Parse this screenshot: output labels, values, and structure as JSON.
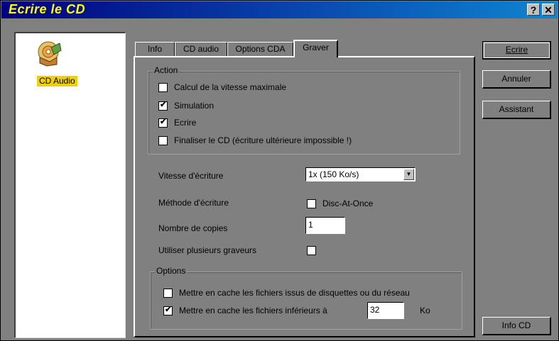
{
  "window": {
    "title": "Ecrire le CD",
    "help_button": "?",
    "close_button": "✕"
  },
  "left_pane": {
    "item_label": "CD Audio",
    "item_icon": "cd-audio-icon"
  },
  "tabs": [
    {
      "label": "Info"
    },
    {
      "label": "CD audio"
    },
    {
      "label": "Options CDA"
    },
    {
      "label": "Graver",
      "active": true
    }
  ],
  "action_group": {
    "title": "Action",
    "items": [
      {
        "label": "Calcul de la vitesse maximale",
        "checked": false
      },
      {
        "label": "Simulation",
        "checked": true
      },
      {
        "label": "Ecrire",
        "checked": true
      },
      {
        "label": "Finaliser le CD (écriture ultérieure impossible !)",
        "checked": false
      }
    ]
  },
  "settings": {
    "speed_label": "Vitesse d'écriture",
    "speed_value": "1x (150 Ko/s)",
    "method_label": "Méthode d'écriture",
    "method_option": "Disc-At-Once",
    "copies_label": "Nombre de copies",
    "copies_value": "1",
    "multi_label": "Utiliser plusieurs graveurs"
  },
  "options_group": {
    "title": "Options",
    "cache_network_label": "Mettre en cache les fichiers issus de disquettes ou du réseau",
    "cache_small_label": "Mettre en cache les fichiers inférieurs à",
    "cache_small_value": "32",
    "cache_small_unit": "Ko"
  },
  "buttons": {
    "write": "Ecrire",
    "cancel": "Annuler",
    "assistant": "Assistant",
    "info_cd": "Info CD"
  }
}
